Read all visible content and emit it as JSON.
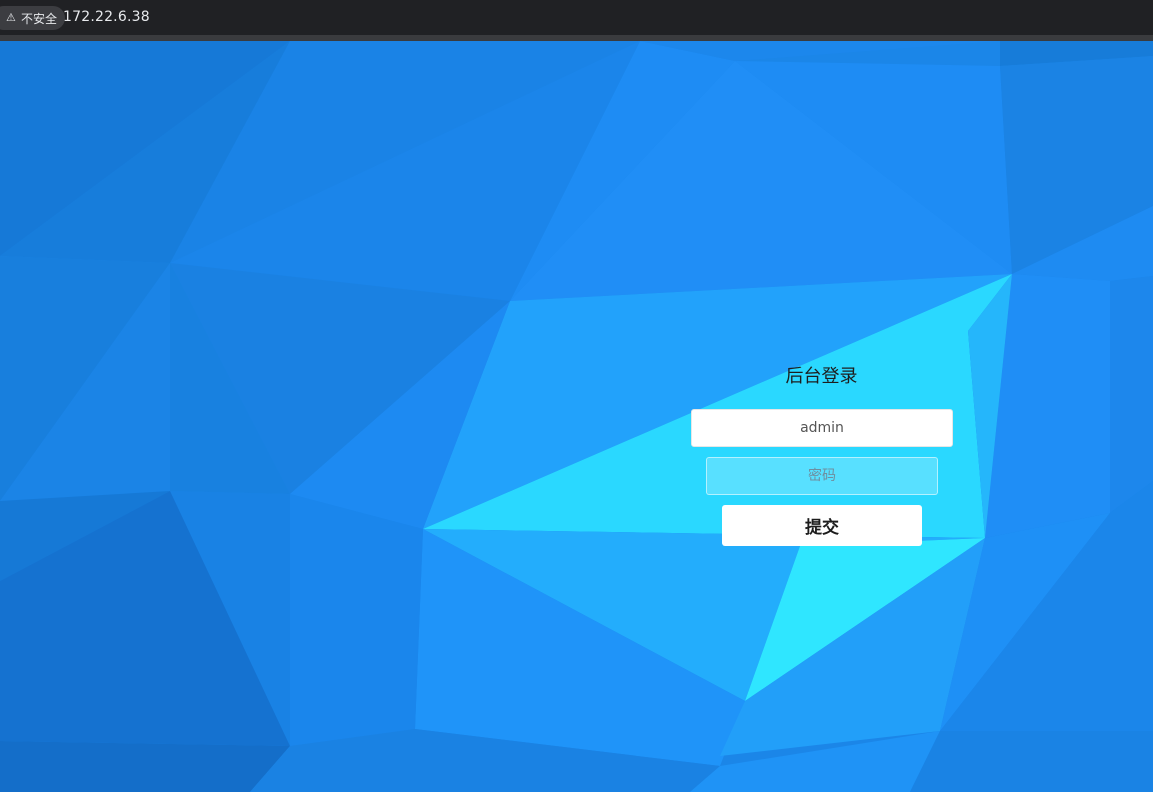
{
  "browser": {
    "security_label": "不安全",
    "security_icon": "warning-icon",
    "url": "172.22.6.38"
  },
  "login": {
    "title": "后台登录",
    "username_value": "admin",
    "password_placeholder": "密码",
    "submit_label": "提交"
  },
  "colors": {
    "background_primary": "#1b86e8",
    "background_highlight": "#2fe6ff",
    "title_text": "#1d1d1d",
    "button_bg": "#ffffff"
  }
}
